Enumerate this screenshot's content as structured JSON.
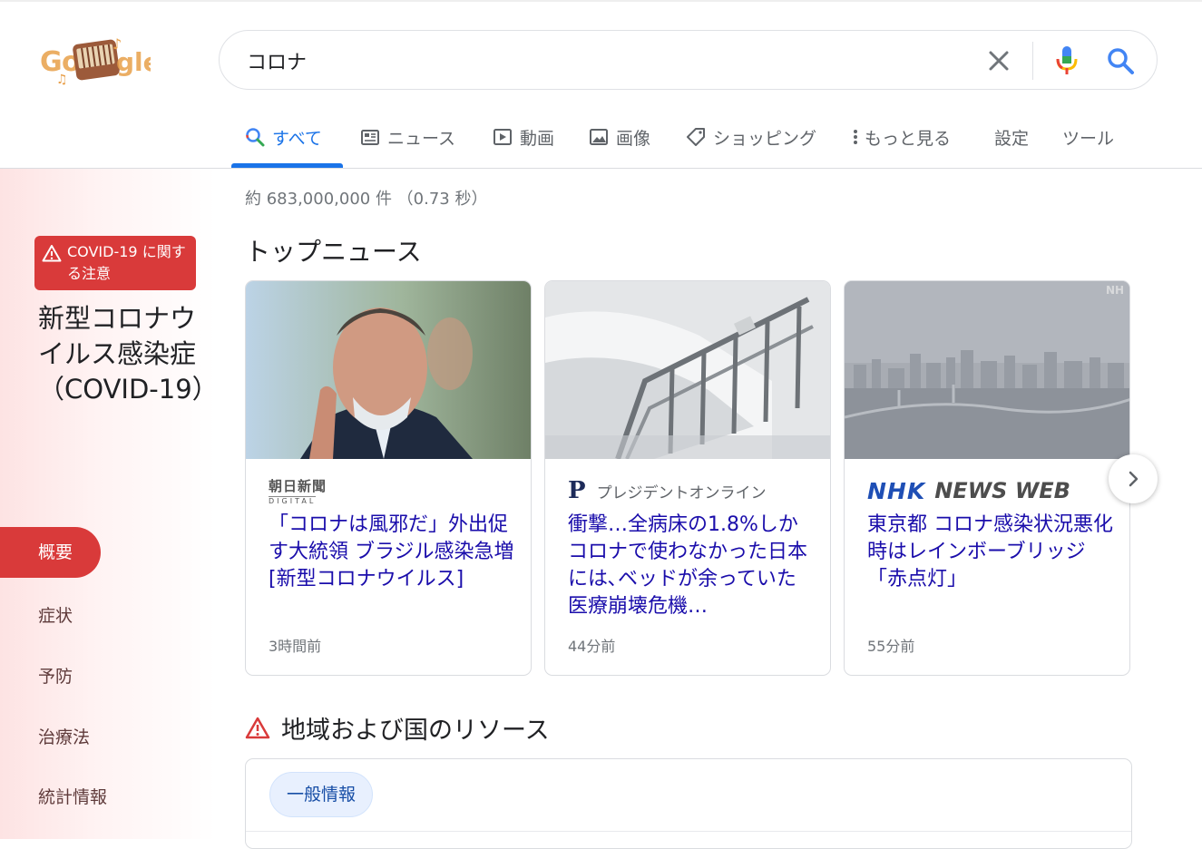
{
  "search": {
    "query": "コロナ"
  },
  "tabs": [
    {
      "label": "すべて",
      "icon": "search-icon",
      "active": true
    },
    {
      "label": "ニュース",
      "icon": "news-icon"
    },
    {
      "label": "動画",
      "icon": "video-icon"
    },
    {
      "label": "画像",
      "icon": "image-icon"
    },
    {
      "label": "ショッピング",
      "icon": "tag-icon"
    },
    {
      "label": "もっと見る",
      "icon": "more-vert-icon"
    },
    {
      "label": "設定"
    },
    {
      "label": "ツール"
    }
  ],
  "results": {
    "stats": "約 683,000,000 件 （0.73 秒）"
  },
  "sidebar": {
    "badge": "COVID-19 に関する注意",
    "title": "新型コロナウイルス感染症（COVID-19）",
    "nav": [
      "概要",
      "症状",
      "予防",
      "治療法",
      "統計情報"
    ]
  },
  "top_news": {
    "heading": "トップニュース",
    "cards": [
      {
        "source_logo": [
          "朝日新聞",
          "DIGITAL"
        ],
        "headline": "「コロナは風邪だ」外出促す大統領 ブラジル感染急増 [新型コロナウイルス]",
        "time": "3時間前"
      },
      {
        "source_logo": [
          "P"
        ],
        "source": "プレジデントオンライン",
        "headline": "衝撃…全病床の1.8%しかコロナで使わなかった日本には､ベッドが余っていた 医療崩壊危機…",
        "time": "44分前"
      },
      {
        "source_logo": [
          "NHK",
          "NEWS WEB"
        ],
        "headline": "東京都 コロナ感染状況悪化時はレインボーブリッジ「赤点灯」",
        "time": "55分前"
      }
    ]
  },
  "resources": {
    "heading": "地域および国のリソース",
    "chip": "一般情報"
  },
  "colors": {
    "accent_blue": "#1a73e8",
    "link": "#1a0dab",
    "covid_red": "#d93a3a"
  }
}
